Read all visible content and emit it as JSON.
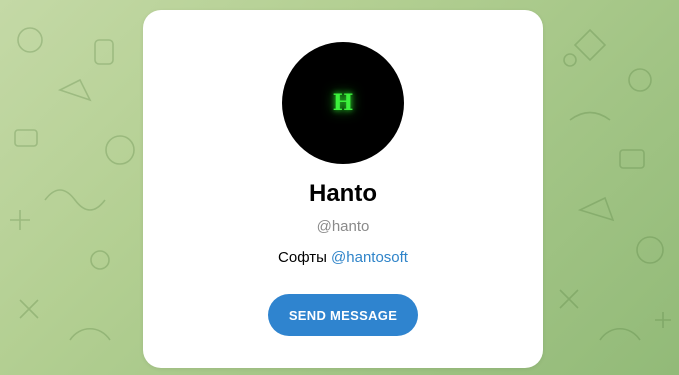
{
  "profile": {
    "avatar_letter": "H",
    "name": "Hanto",
    "username": "@hanto",
    "bio_text": "Софты",
    "bio_link": "@hantosoft"
  },
  "actions": {
    "send_message_label": "SEND MESSAGE"
  },
  "colors": {
    "background": "#b3cf92",
    "card": "#ffffff",
    "avatar_bg": "#000000",
    "avatar_letter": "#3cf03c",
    "link": "#2f84c9",
    "button": "#2f84cf"
  }
}
